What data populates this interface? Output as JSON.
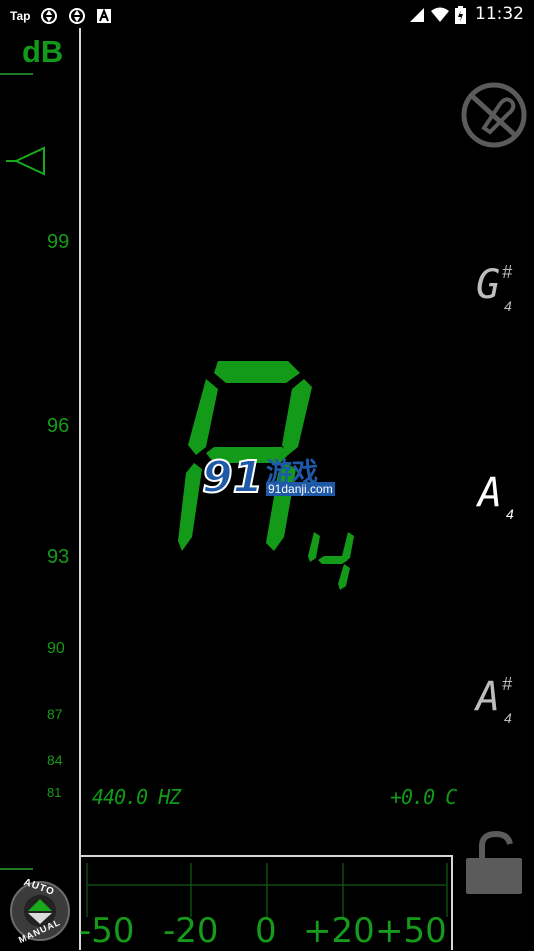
{
  "status_bar": {
    "app_label": "Tap",
    "time": "11:32"
  },
  "db_panel": {
    "title": "dB",
    "scale": [
      "99",
      "96",
      "93",
      "90",
      "87",
      "84",
      "81"
    ]
  },
  "main": {
    "note": "A",
    "octave": "4",
    "frequency": "440.0 HZ",
    "cents": "+0.0 C"
  },
  "note_buttons": [
    {
      "note": "G",
      "accidental": "#",
      "octave": "4"
    },
    {
      "note": "A",
      "accidental": "",
      "octave": "4"
    },
    {
      "note": "A",
      "accidental": "#",
      "octave": "4"
    }
  ],
  "mode": {
    "top": "AUTO",
    "bottom": "MANUAL"
  },
  "meter": {
    "labels": [
      "-50",
      "-20",
      "0",
      "+20",
      "+50"
    ]
  },
  "watermark": "91danji.com",
  "colors": {
    "accent_green": "#149a19",
    "divider": "#d6d6d6",
    "icon_gray": "#5b5b5b"
  }
}
